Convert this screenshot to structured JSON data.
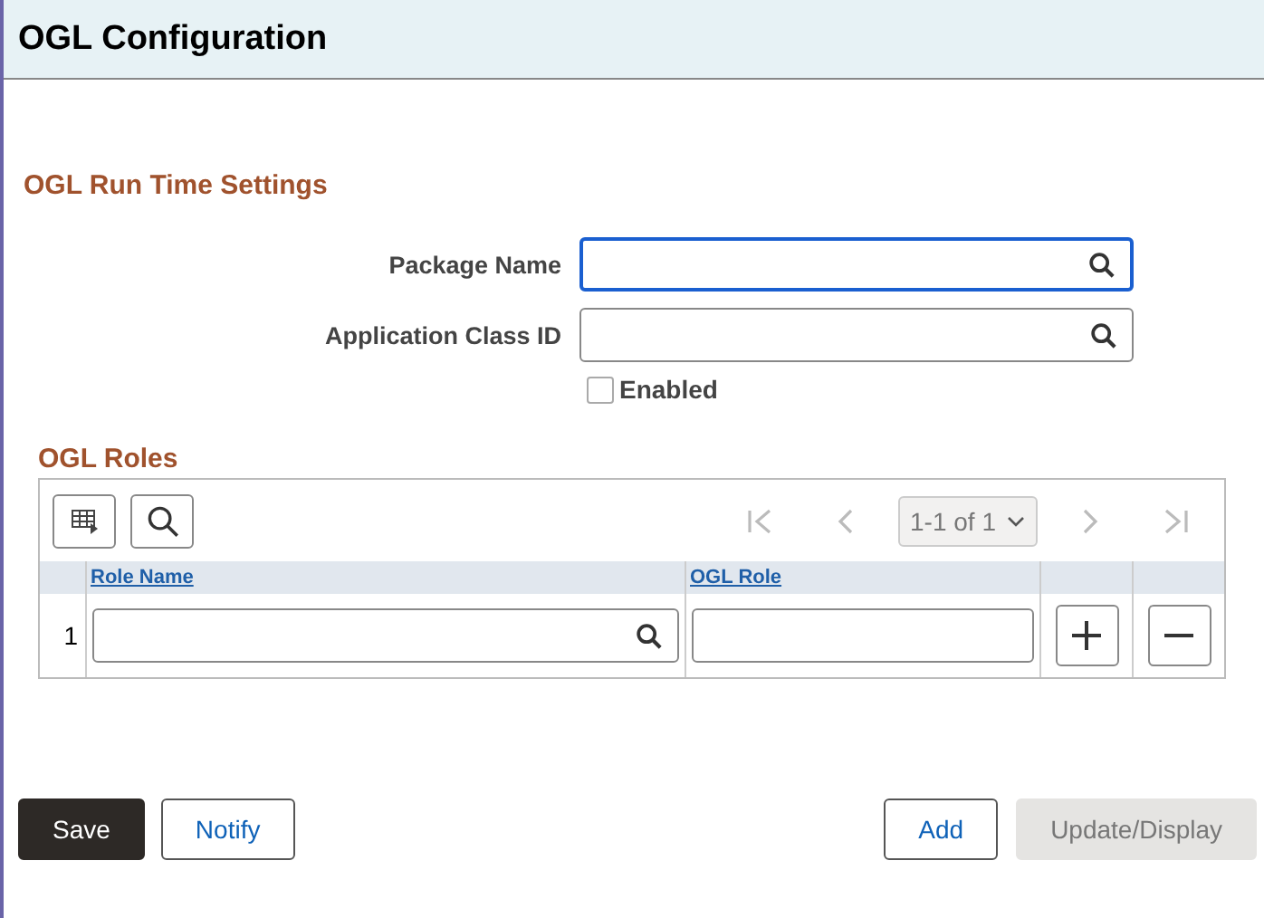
{
  "page": {
    "title": "OGL Configuration"
  },
  "settings": {
    "title": "OGL Run Time Settings",
    "fields": [
      {
        "label": "Package Name",
        "focused": true,
        "lookup": true
      },
      {
        "label": "Application Class ID",
        "focused": false,
        "lookup": true
      }
    ],
    "enabled": {
      "label": "Enabled",
      "checked": false
    }
  },
  "roles": {
    "title": "OGL Roles",
    "pagination": "1-1 of 1",
    "nav": [
      {
        "kind": "first",
        "disabled": true
      },
      {
        "kind": "prev",
        "disabled": true
      },
      {
        "kind": "next",
        "disabled": true
      },
      {
        "kind": "last",
        "disabled": true
      }
    ],
    "columns": [
      "Role Name",
      "OGL Role"
    ],
    "rows": [
      {
        "number": "1"
      }
    ]
  },
  "buttons": [
    {
      "label": "Save",
      "kind": "primary"
    },
    {
      "label": "Notify",
      "kind": "secondary"
    },
    {
      "label": "Add",
      "kind": "secondary"
    },
    {
      "label": "Update/Display",
      "kind": "disabled"
    }
  ]
}
